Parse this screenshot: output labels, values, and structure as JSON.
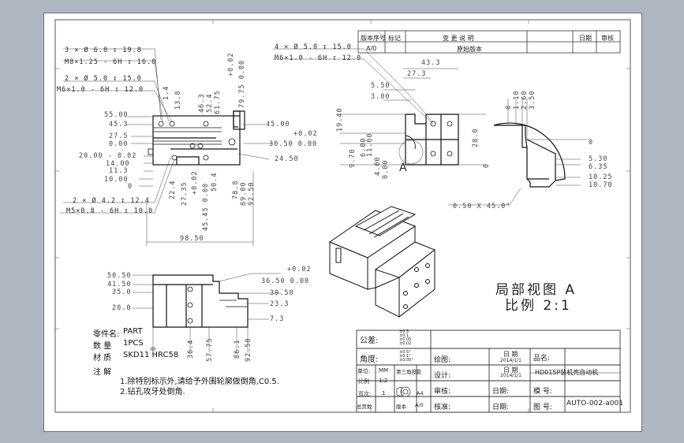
{
  "revision_table": {
    "headers": [
      "版本序号",
      "标记",
      "变 更 说 明",
      "日期",
      "审核"
    ],
    "row1": {
      "version": "A/0",
      "desc": "原始版本"
    }
  },
  "view_left_top": {
    "callouts": [
      "3 × Ø 6.8 ↧ 19.8",
      "M8×1.25 - 6H ↧ 16.0",
      "2 × Ø 5.0 ↧ 15.0",
      "M6×1.0 - 6H ↧ 12.0",
      "2 × Ø 4.2 ↧ 12.4",
      "M5×0.8 - 6H ↧ 10.0"
    ],
    "left_dims": [
      "55.00",
      "45.3",
      "27.5",
      "0.00",
      "20.00 - 0.02",
      "14.00",
      "11.3",
      "10.00",
      "0"
    ],
    "top_dims": [
      "13.8",
      "1.4",
      "46.3",
      "52.4",
      "61.75",
      "+0.02",
      "79.75 0.00"
    ],
    "right_dims": [
      "45.00",
      "+0.02",
      "30.50 0.00",
      "24.50"
    ],
    "bottom_dims": [
      "22.4",
      "27.35",
      "+0.02",
      "45.45 0.00",
      "50.4",
      "78.8",
      "89.00",
      "92.50"
    ],
    "width_dim": "98.50"
  },
  "view_left_bottom": {
    "left_dims": [
      "50.50",
      "41.50",
      "35.0",
      "20.0"
    ],
    "right_dims": [
      "+0.02",
      "36.50 0.00",
      "30.50",
      "23.3",
      "7.3"
    ],
    "bottom_dims": [
      "0",
      "36.4",
      "57.75",
      "86.1",
      "92.50"
    ]
  },
  "view_right_top": {
    "callouts": [
      "4 × Ø 5.0 ↧ 15.0",
      "M6×1.0 - 6H ↧ 12.0"
    ],
    "top_dims": [
      "43.3",
      "27.3",
      "5.50",
      "3.00"
    ],
    "left_dims": [
      "19.40",
      "9.70",
      "4.00",
      "0.00",
      "6.00",
      "11.00"
    ],
    "right_dims": [
      "28.0",
      "0"
    ],
    "label": "A"
  },
  "detail_view": {
    "top_dims": [
      "0",
      "1.10",
      "2.60",
      "3.50"
    ],
    "right_dims": [
      "0",
      "5.30",
      "6.35",
      "10.25",
      "10.70"
    ],
    "chamfer": "0.50 X 45.0°",
    "title_line1": "局部视图 A",
    "title_line2": "比例 2:1"
  },
  "notes": {
    "part_name_label": "零件名:",
    "part_name": "PART",
    "qty_label": "数 量",
    "qty": "1PCS",
    "material_label": "材 质",
    "material": "SKD11 HRC58",
    "notes_title": "注 解",
    "note1": "1.除特别标示外,请给予外围轮廓做倒角,C0.5.",
    "note2": "2.钻孔攻牙处倒角."
  },
  "title_block": {
    "tolerance_label": "公差:",
    "tolerance_values": [
      "±0.5",
      "±0.1",
      "±0.05",
      "±0.02"
    ],
    "angle_label": "角度:",
    "angle_values": [
      "±0.5°",
      "±0.1°",
      "±0.05°"
    ],
    "unit_label": "单位:",
    "unit": "MM",
    "projection": "第三角投影",
    "scale_label": "比例",
    "scale": "1:2",
    "page_label": "页次:",
    "page": "1",
    "size_label": "图幅:",
    "size": "A4",
    "pages_label": "总页数:",
    "version_label": "版本:",
    "version": "A/0",
    "drawn_label": "绘图:",
    "design_label": "设计:",
    "review_label": "审核:",
    "approve_label": "核准:",
    "date_label": "日 期",
    "date1": "2014/1/1",
    "date2": "2014/1/1",
    "date3_label": "日期:",
    "date4_label": "日期:",
    "product_label": "品名:",
    "product": "HD015P装机壳自动机",
    "model_label": "模 号:",
    "drawing_no_label": "图 号:",
    "drawing_no": "AUTO-002-a001"
  }
}
